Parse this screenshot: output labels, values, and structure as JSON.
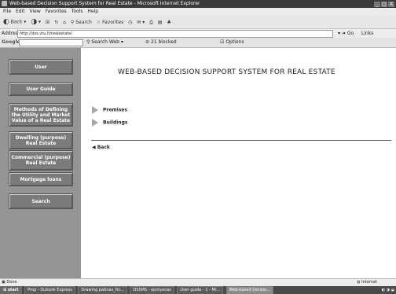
{
  "window": {
    "title": "Web-based Decision Support System for Real Estate - Microsoft Internet Explorer",
    "controls": [
      "_",
      "□",
      "X"
    ]
  },
  "menu": [
    "File",
    "Edit",
    "View",
    "Favorites",
    "Tools",
    "Help"
  ],
  "toolbar": {
    "back": "Back",
    "search": "Search",
    "favorites": "Favorites"
  },
  "address": {
    "label": "Address",
    "url": "http://dss.vtu.lt/realestate/",
    "go": "Go",
    "links": "Links"
  },
  "google": {
    "label": "Google",
    "search_web": "Search Web",
    "blocked": "21 blocked",
    "options": "Options"
  },
  "sidebar": {
    "items": [
      {
        "label": "User"
      },
      {
        "label": "User Guide"
      },
      {
        "label": "Methods of Defining the Utility and Market Value of a Real Estate"
      },
      {
        "label": "Dwelling (purpose) Real Estate"
      },
      {
        "label": "Commercial (purpose) Real Estate"
      },
      {
        "label": "Mortgage loans"
      },
      {
        "label": "Search"
      }
    ]
  },
  "main": {
    "title": "WEB-BASED DECISION SUPPORT SYSTEM FOR REAL ESTATE",
    "links": [
      {
        "label": "Premises"
      },
      {
        "label": "Buildings"
      }
    ],
    "back": "Back"
  },
  "status": {
    "text": "Done",
    "zone": "Internet"
  },
  "taskbar": {
    "start": "start",
    "tasks": [
      {
        "label": "Prop - Outlook Express"
      },
      {
        "label": "Drawing patinas_fin..."
      },
      {
        "label": "DSSMS - eproyecas"
      },
      {
        "label": "User guide - 1 - Mi..."
      },
      {
        "label": "Web-based Decisio..."
      }
    ]
  }
}
